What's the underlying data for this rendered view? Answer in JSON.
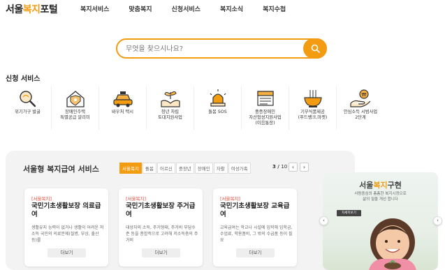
{
  "logo": {
    "part1": "서울",
    "part2": "복지",
    "part3": "포털"
  },
  "nav": [
    "복지서비스",
    "맞춤복지",
    "신청서비스",
    "복지소식",
    "복지수첩"
  ],
  "search": {
    "placeholder": "무엇을 찾으시나요?"
  },
  "apply_section": {
    "title": "신청 서비스",
    "items": [
      {
        "label": "위기가구 발굴",
        "icon": "magnifier-icon"
      },
      {
        "label": "장애인주택\n특별공급 알리미",
        "icon": "house-shield-icon"
      },
      {
        "label": "바우처 택시",
        "icon": "taxi-icon"
      },
      {
        "label": "청년 자립\n토대지원사업",
        "icon": "sprout-hands-icon"
      },
      {
        "label": "돌봄 SOS",
        "icon": "siren-icon"
      },
      {
        "label": "중증장애인\n자산형성지원사업\n(이음통장)",
        "icon": "passbook-icon"
      },
      {
        "label": "기부식품제공\n(푸드뱅크,마켓)",
        "icon": "food-bowl-icon"
      },
      {
        "label": "안심소득 시범사업\n2단계",
        "icon": "coin-hand-icon"
      }
    ]
  },
  "benefits": {
    "title": "서울형 복지급여 서비스",
    "tabs": [
      "서울복지",
      "돌봄",
      "어르신",
      "중장년",
      "장애인",
      "자활",
      "여성가족"
    ],
    "active_tab": 0,
    "page_current": "3",
    "page_total": "10",
    "prev_label": "‹",
    "next_label": "›",
    "cards": [
      {
        "tag": "[서울복지]",
        "title": "국민기초생활보장 의료급여",
        "desc": "생활유지 능력이 없거나 생활이 어려운 저소득 국민의 의료문제(질병, 부상, 출산 등)를",
        "more": "더보기"
      },
      {
        "tag": "[서울복지]",
        "title": "국민기초생활보장 주거급여",
        "desc": "대상자의 소득, 주거형태, 주거비 부담수준 등을 종합적으로 고려해 저소득층의 주거비",
        "more": "더보기"
      },
      {
        "tag": "[서울복지]",
        "title": "국민기초생활보장 교육급여",
        "desc": "교육급여는 학교나 시설에 입학해 입학금, 수업료, 학용품비, 그 밖의 수급품 등이 필요",
        "more": "더보기"
      }
    ]
  },
  "banner": {
    "title_part1": "서울",
    "title_part2": "복지",
    "title_part3": "구현",
    "subtitle": "사람중심의 촘촘한 복지시정으로\n삶의 질을 개선 합니다",
    "button": "자세히보기",
    "prev_label": "‹",
    "next_label": "›"
  },
  "colors": {
    "accent": "#f39c12",
    "tag_red": "#e74c3c"
  }
}
